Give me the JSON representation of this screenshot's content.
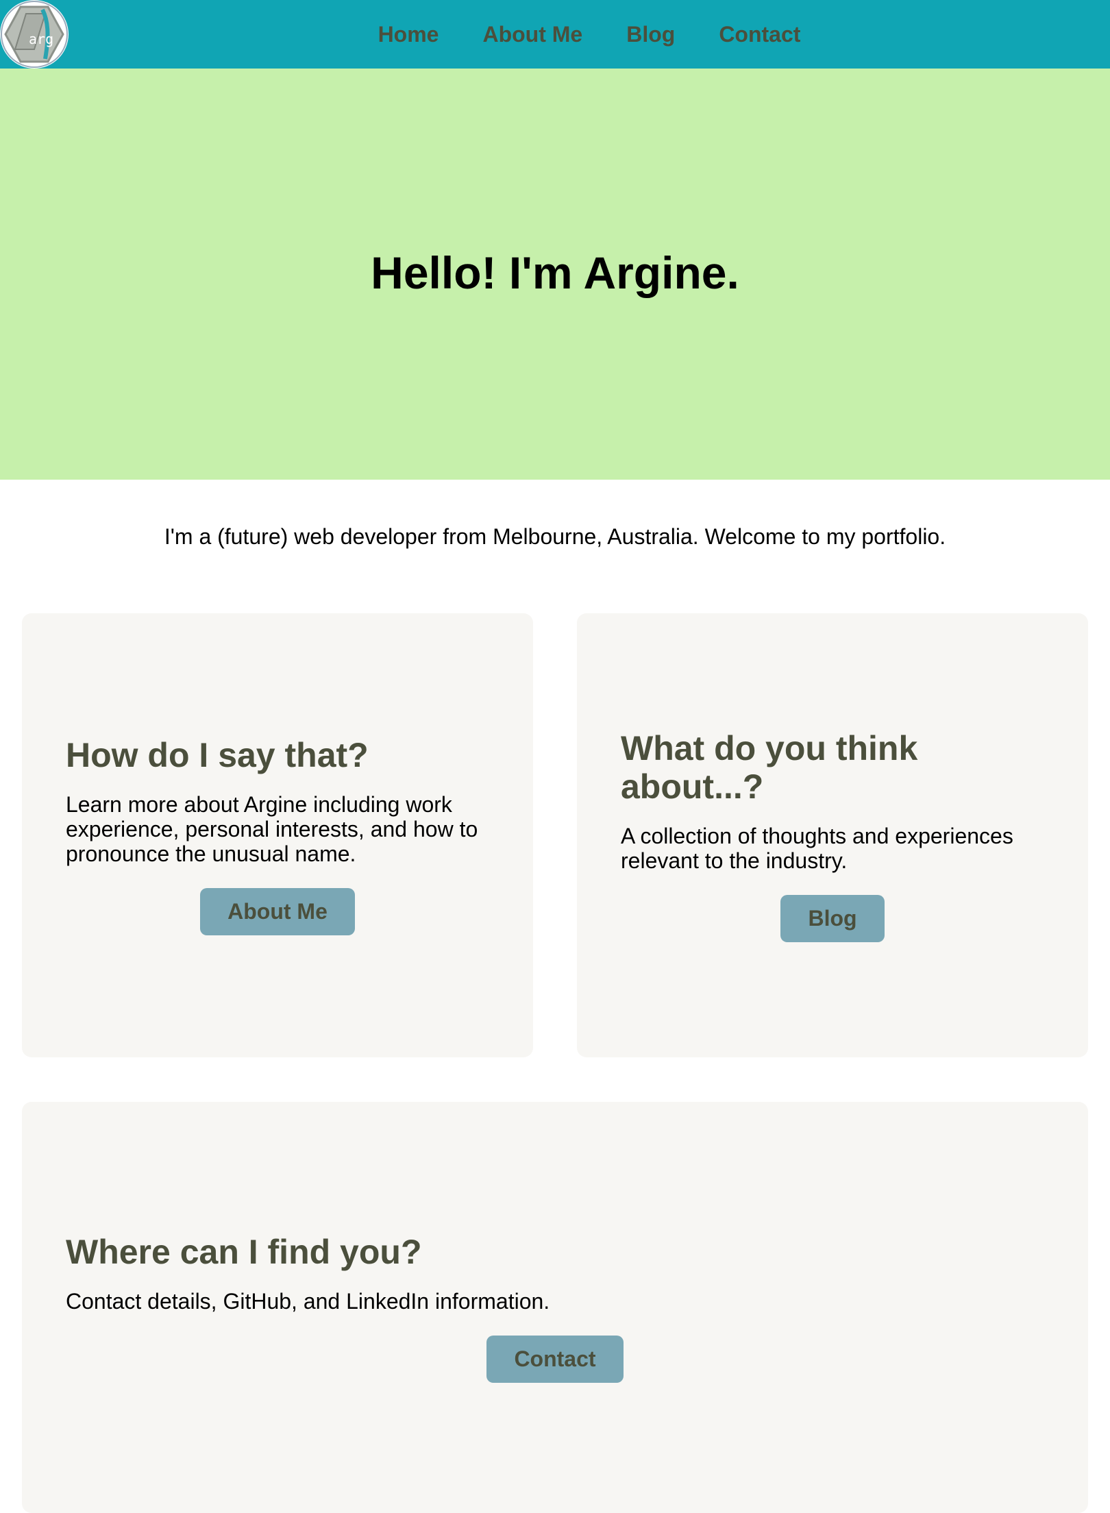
{
  "header": {
    "logo_text": "arg",
    "nav": [
      {
        "label": "Home"
      },
      {
        "label": "About Me"
      },
      {
        "label": "Blog"
      },
      {
        "label": "Contact"
      }
    ],
    "bg_color": "#10a5b4"
  },
  "hero": {
    "title": "Hello! I'm Argine.",
    "bg_color": "#c6f0ab"
  },
  "intro": {
    "text": "I'm a (future) web developer from Melbourne, Australia. Welcome to my portfolio."
  },
  "cards": [
    {
      "title": "How do I say that?",
      "body": "Learn more about Argine including work experience, personal interests, and how to pronounce the unusual name.",
      "button": "About Me"
    },
    {
      "title": "What do you think about...?",
      "body": "A collection of thoughts and experiences relevant to the industry.",
      "button": "Blog"
    },
    {
      "title": "Where can I find you?",
      "body": "Contact details, GitHub, and LinkedIn information.",
      "button": "Contact"
    }
  ],
  "colors": {
    "heading": "#4b4f3c",
    "button_bg": "#7aa7b5",
    "card_bg": "#f7f6f3"
  }
}
